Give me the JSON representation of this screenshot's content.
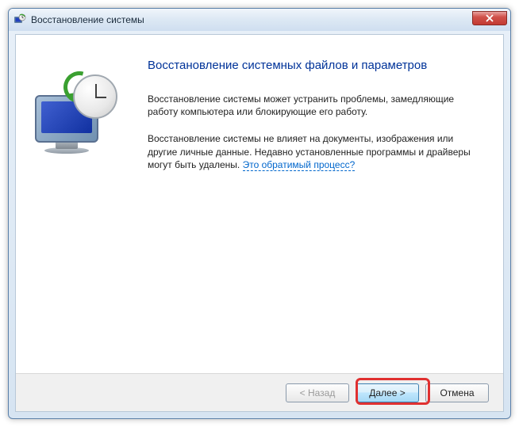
{
  "window": {
    "title": "Восстановление системы"
  },
  "content": {
    "heading": "Восстановление системных файлов и параметров",
    "para1": "Восстановление системы может устранить проблемы, замедляющие работу компьютера или блокирующие его работу.",
    "para2_a": "Восстановление системы не влияет на документы, изображения или другие личные данные. Недавно установленные программы и драйверы могут быть удалены. ",
    "para2_link": "Это обратимый процесс?"
  },
  "buttons": {
    "back": "< Назад",
    "next": "Далее >",
    "cancel": "Отмена"
  }
}
